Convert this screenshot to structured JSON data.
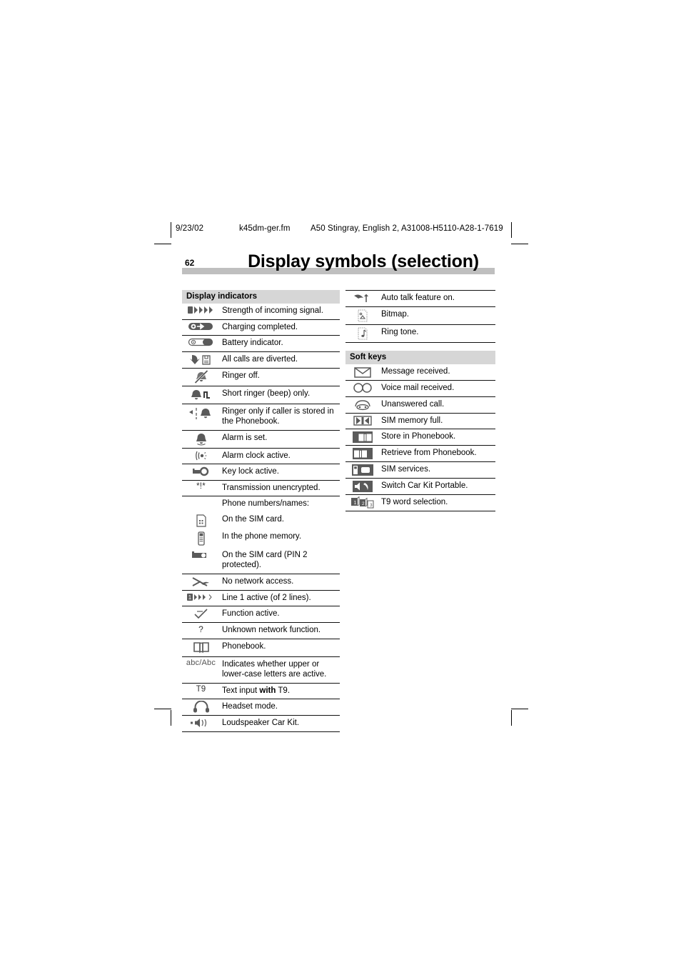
{
  "header": {
    "date": "9/23/02",
    "filename": "k45dm-ger.fm",
    "doc_ref": "A50 Stingray, English 2, A31008-H5110-A28-1-7619"
  },
  "page_number": "62",
  "chapter_title": "Display symbols (selection)",
  "colors": {
    "section_header_bg": "#d6d6d6",
    "title_band": "#bfbfbf",
    "icon_gray": "#5a5a5a",
    "text": "#000000"
  },
  "left_column": {
    "section_label": "Display indicators",
    "rows": [
      {
        "icon": "signal-strength-icon",
        "text": "Strength of incoming signal."
      },
      {
        "icon": "battery-charged-icon",
        "text": "Charging completed."
      },
      {
        "icon": "battery-indicator-icon",
        "text": "Battery indicator."
      },
      {
        "icon": "call-divert-icon",
        "text": "All calls are diverted."
      },
      {
        "icon": "ringer-off-icon",
        "text": "Ringer off."
      },
      {
        "icon": "short-ringer-beep-icon",
        "text": "Short ringer (beep) only."
      },
      {
        "icon": "ringer-phonebook-only-icon",
        "text": "Ringer only if caller is stored in the Phonebook."
      },
      {
        "icon": "alarm-bell-icon",
        "text": "Alarm is set."
      },
      {
        "icon": "alarm-clock-icon",
        "text": "Alarm clock active."
      },
      {
        "icon": "key-lock-icon",
        "text": "Key lock active."
      },
      {
        "icon": "unencrypted-icon",
        "text": "Transmission unencrypted."
      },
      {
        "icon": "none",
        "text": "Phone numbers/names:"
      },
      {
        "icon": "sim-card-icon",
        "text": "On the SIM card."
      },
      {
        "icon": "phone-memory-icon",
        "text": "In the phone memory."
      },
      {
        "icon": "sim-pin2-icon",
        "text": "On the SIM card (PIN 2 protected)."
      },
      {
        "icon": "no-network-icon",
        "text": "No network access."
      },
      {
        "icon": "line-1-active-icon",
        "text": "Line 1 active (of 2 lines)."
      },
      {
        "icon": "function-active-icon",
        "text": "Function active."
      },
      {
        "icon": "question-mark-icon",
        "text": "Unknown network function."
      },
      {
        "icon": "phonebook-icon",
        "text": "Phonebook."
      },
      {
        "icon": "abc-case-icon",
        "text": "Indicates whether upper or lower-case letters are active."
      },
      {
        "icon": "t9-icon",
        "text": "Text input with T9."
      },
      {
        "icon": "headset-icon",
        "text": "Headset mode."
      },
      {
        "icon": "loudspeaker-carkit-icon",
        "text": "Loudspeaker Car Kit."
      }
    ],
    "icon_labels": {
      "unencrypted": "*!*",
      "question_mark": "?",
      "abc_case": "abc/Abc",
      "t9": "T9"
    },
    "t9_text": {
      "before": "Text input ",
      "bold": "with",
      "after": " T9."
    }
  },
  "right_column": {
    "top_rows": [
      {
        "icon": "auto-talk-icon",
        "text": "Auto talk feature on."
      },
      {
        "icon": "bitmap-icon",
        "text": "Bitmap."
      },
      {
        "icon": "ring-tone-icon",
        "text": "Ring tone."
      }
    ],
    "section_label": "Soft keys",
    "rows": [
      {
        "icon": "envelope-icon",
        "text": "Message received."
      },
      {
        "icon": "voice-mail-icon",
        "text": "Voice mail received."
      },
      {
        "icon": "unanswered-call-icon",
        "text": "Unanswered call."
      },
      {
        "icon": "sim-memory-full-icon",
        "text": "SIM memory full."
      },
      {
        "icon": "store-phonebook-icon",
        "text": "Store in Phonebook."
      },
      {
        "icon": "retrieve-phonebook-icon",
        "text": "Retrieve from Phonebook."
      },
      {
        "icon": "sim-services-icon",
        "text": "SIM services."
      },
      {
        "icon": "switch-carkit-icon",
        "text": "Switch Car Kit Portable."
      },
      {
        "icon": "t9-word-selection-icon",
        "text": "T9 word selection."
      }
    ]
  }
}
